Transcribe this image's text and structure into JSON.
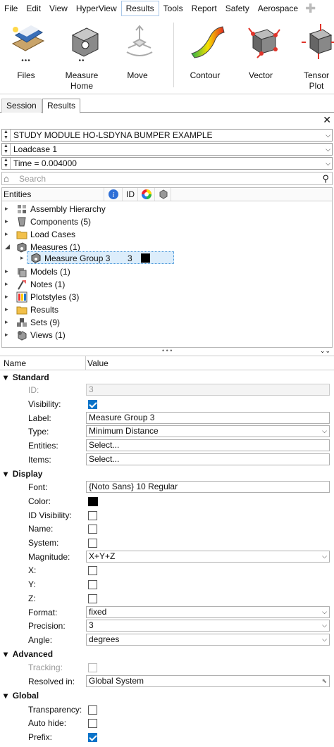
{
  "menubar": {
    "items": [
      "File",
      "Edit",
      "View",
      "HyperView",
      "Results",
      "Tools",
      "Report",
      "Safety",
      "Aerospace"
    ],
    "active": "Results"
  },
  "ribbon": {
    "tools": [
      {
        "label": "Files",
        "icon": "files-icon"
      },
      {
        "label": "Measure",
        "label2": "Home",
        "icon": "measure-icon"
      },
      {
        "label": "Move",
        "icon": "move-icon"
      },
      {
        "label": "Contour",
        "icon": "contour-icon"
      },
      {
        "label": "Vector",
        "icon": "vector-icon"
      },
      {
        "label": "Tensor",
        "label2": "Plot",
        "icon": "tensor-plot-icon"
      }
    ]
  },
  "tabs": [
    "Session",
    "Results"
  ],
  "active_tab": "Results",
  "dropdowns": {
    "model": "STUDY MODULE HO-LSDYNA BUMPER EXAMPLE",
    "loadcase": "Loadcase 1",
    "time": "Time = 0.004000"
  },
  "search": {
    "placeholder": "Search"
  },
  "browser": {
    "header": {
      "entities": "Entities",
      "id": "ID"
    },
    "items": [
      {
        "label": "Assembly Hierarchy",
        "icon": "assembly-icon",
        "expanded": false
      },
      {
        "label": "Components (5)",
        "icon": "component-icon",
        "expanded": false
      },
      {
        "label": "Load Cases",
        "icon": "folder-icon",
        "expanded": false
      },
      {
        "label": "Measures (1)",
        "icon": "measure-icon",
        "expanded": true
      },
      {
        "label": "Models (1)",
        "icon": "model-icon",
        "expanded": false
      },
      {
        "label": "Notes (1)",
        "icon": "note-icon",
        "expanded": false
      },
      {
        "label": "Plotstyles (3)",
        "icon": "plotstyle-icon",
        "expanded": false
      },
      {
        "label": "Results",
        "icon": "folder-icon",
        "expanded": false
      },
      {
        "label": "Sets (9)",
        "icon": "set-icon",
        "expanded": false
      },
      {
        "label": "Views (1)",
        "icon": "view-icon",
        "expanded": false
      }
    ],
    "child": {
      "label": "Measure Group 3",
      "id": "3",
      "color": "#000000"
    }
  },
  "properties": {
    "header": {
      "name": "Name",
      "value": "Value"
    },
    "sections": {
      "standard": "Standard",
      "display": "Display",
      "advanced": "Advanced",
      "global": "Global"
    },
    "rows": {
      "id": {
        "label": "ID:",
        "value": "3"
      },
      "visibility": {
        "label": "Visibility:",
        "checked": true
      },
      "label": {
        "label": "Label:",
        "value": "Measure Group 3"
      },
      "type": {
        "label": "Type:",
        "value": "Minimum Distance"
      },
      "entities": {
        "label": "Entities:",
        "value": "Select..."
      },
      "items": {
        "label": "Items:",
        "value": "Select..."
      },
      "font": {
        "label": "Font:",
        "value": "{Noto Sans} 10 Regular"
      },
      "color": {
        "label": "Color:",
        "value": "#000000"
      },
      "id_visibility": {
        "label": "ID Visibility:",
        "checked": false
      },
      "name": {
        "label": "Name:",
        "checked": false
      },
      "system": {
        "label": "System:",
        "checked": false
      },
      "magnitude": {
        "label": "Magnitude:",
        "value": "X+Y+Z"
      },
      "x": {
        "label": "X:",
        "checked": false
      },
      "y": {
        "label": "Y:",
        "checked": false
      },
      "z": {
        "label": "Z:",
        "checked": false
      },
      "format": {
        "label": "Format:",
        "value": "fixed"
      },
      "precision": {
        "label": "Precision:",
        "value": "3"
      },
      "angle": {
        "label": "Angle:",
        "value": "degrees"
      },
      "tracking": {
        "label": "Tracking:",
        "checked": false
      },
      "resolved_in": {
        "label": "Resolved in:",
        "value": "Global System"
      },
      "transparency": {
        "label": "Transparency:",
        "checked": false
      },
      "auto_hide": {
        "label": "Auto hide:",
        "checked": false
      },
      "prefix": {
        "label": "Prefix:",
        "checked": true
      }
    }
  }
}
